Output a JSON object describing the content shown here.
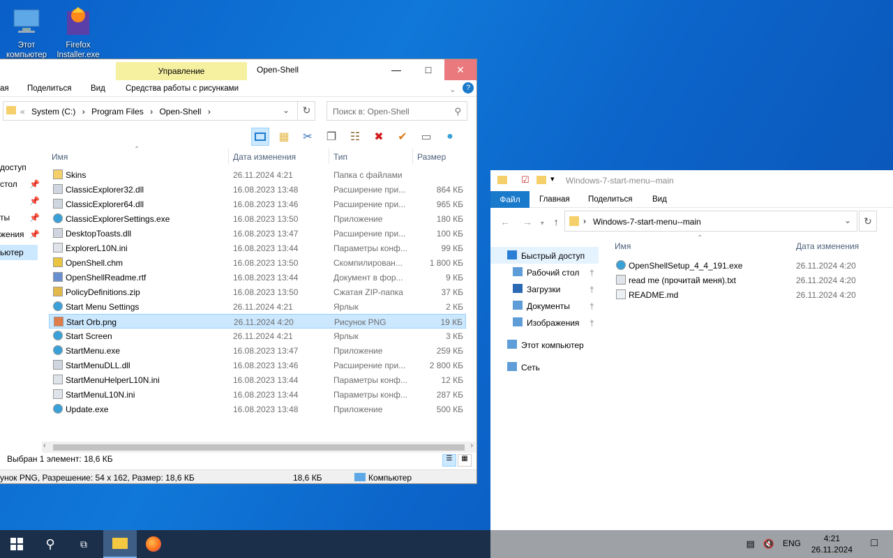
{
  "desktop": {
    "icons": [
      {
        "label": "Этот компьютер",
        "icon": "computer-icon"
      },
      {
        "label": "Firefox Installer.exe",
        "icon": "firefox-installer-icon"
      }
    ]
  },
  "window1": {
    "context_tab": "Управление",
    "title": "Open-Shell",
    "ribbon_tabs": [
      "Поделиться",
      "Вид",
      "Средства работы с рисунками"
    ],
    "ribbon_partial": "ая",
    "breadcrumb": {
      "chevron": "«",
      "parts": [
        "System (C:)",
        "Program Files",
        "Open-Shell"
      ]
    },
    "search_placeholder": "Поиск в: Open-Shell",
    "columns": {
      "name": "Имя",
      "date": "Дата изменения",
      "type": "Тип",
      "size": "Размер"
    },
    "nav_items": [
      "доступ",
      "стол",
      "ты",
      "жения",
      "ьютер"
    ],
    "files": [
      {
        "name": "Skins",
        "date": "26.11.2024 4:21",
        "type": "Папка с файлами",
        "size": "",
        "icon": "folder-icon"
      },
      {
        "name": "ClassicExplorer32.dll",
        "date": "16.08.2023 13:48",
        "type": "Расширение при...",
        "size": "864 КБ",
        "icon": "dll-icon"
      },
      {
        "name": "ClassicExplorer64.dll",
        "date": "16.08.2023 13:46",
        "type": "Расширение при...",
        "size": "965 КБ",
        "icon": "dll-icon"
      },
      {
        "name": "ClassicExplorerSettings.exe",
        "date": "16.08.2023 13:50",
        "type": "Приложение",
        "size": "180 КБ",
        "icon": "shell-icon"
      },
      {
        "name": "DesktopToasts.dll",
        "date": "16.08.2023 13:47",
        "type": "Расширение при...",
        "size": "100 КБ",
        "icon": "dll-icon"
      },
      {
        "name": "ExplorerL10N.ini",
        "date": "16.08.2023 13:44",
        "type": "Параметры конф...",
        "size": "99 КБ",
        "icon": "ini-icon"
      },
      {
        "name": "OpenShell.chm",
        "date": "16.08.2023 13:50",
        "type": "Скомпилирован...",
        "size": "1 800 КБ",
        "icon": "help-icon"
      },
      {
        "name": "OpenShellReadme.rtf",
        "date": "16.08.2023 13:44",
        "type": "Документ в фор...",
        "size": "9 КБ",
        "icon": "doc-icon"
      },
      {
        "name": "PolicyDefinitions.zip",
        "date": "16.08.2023 13:50",
        "type": "Сжатая ZIP-папка",
        "size": "37 КБ",
        "icon": "zip-icon"
      },
      {
        "name": "Start Menu Settings",
        "date": "26.11.2024 4:21",
        "type": "Ярлык",
        "size": "2 КБ",
        "icon": "shortcut-icon"
      },
      {
        "name": "Start Orb.png",
        "date": "26.11.2024 4:20",
        "type": "Рисунок PNG",
        "size": "19 КБ",
        "icon": "image-icon",
        "selected": true
      },
      {
        "name": "Start Screen",
        "date": "26.11.2024 4:21",
        "type": "Ярлык",
        "size": "3 КБ",
        "icon": "shortcut-icon"
      },
      {
        "name": "StartMenu.exe",
        "date": "16.08.2023 13:47",
        "type": "Приложение",
        "size": "259 КБ",
        "icon": "shell-icon"
      },
      {
        "name": "StartMenuDLL.dll",
        "date": "16.08.2023 13:46",
        "type": "Расширение при...",
        "size": "2 800 КБ",
        "icon": "dll-icon"
      },
      {
        "name": "StartMenuHelperL10N.ini",
        "date": "16.08.2023 13:44",
        "type": "Параметры конф...",
        "size": "12 КБ",
        "icon": "ini-icon"
      },
      {
        "name": "StartMenuL10N.ini",
        "date": "16.08.2023 13:44",
        "type": "Параметры конф...",
        "size": "287 КБ",
        "icon": "ini-icon"
      },
      {
        "name": "Update.exe",
        "date": "16.08.2023 13:48",
        "type": "Приложение",
        "size": "500 КБ",
        "icon": "shell-icon"
      }
    ],
    "status": "Выбран 1 элемент: 18,6 КБ",
    "details": {
      "info": "унок PNG, Разрешение: 54 x 162, Размер: 18,6 КБ",
      "size": "18,6 КБ",
      "location": "Компьютер"
    }
  },
  "window2": {
    "title": "Windows-7-start-menu--main",
    "ribbon": {
      "file": "Файл",
      "tabs": [
        "Главная",
        "Поделиться",
        "Вид"
      ]
    },
    "address": "Windows-7-start-menu--main",
    "columns": {
      "name": "Имя",
      "date": "Дата изменения"
    },
    "sidebar": [
      {
        "label": "Быстрый доступ",
        "icon": "star-icon"
      },
      {
        "label": "Рабочий стол",
        "icon": "desktop-icon"
      },
      {
        "label": "Загрузки",
        "icon": "download-icon"
      },
      {
        "label": "Документы",
        "icon": "documents-icon"
      },
      {
        "label": "Изображения",
        "icon": "pictures-icon"
      },
      {
        "label": "Этот компьютер",
        "icon": "computer-icon"
      },
      {
        "label": "Сеть",
        "icon": "network-icon"
      }
    ],
    "files": [
      {
        "name": "OpenShellSetup_4_4_191.exe",
        "date": "26.11.2024 4:20",
        "icon": "shell-icon"
      },
      {
        "name": "read me (прочитай меня).txt",
        "date": "26.11.2024 4:20",
        "icon": "txt-icon"
      },
      {
        "name": "README.md",
        "date": "26.11.2024 4:20",
        "icon": "file-icon"
      }
    ]
  },
  "taskbar": {
    "lang": "ENG",
    "time": "4:21",
    "date": "26.11.2024"
  },
  "colors": {
    "accent": "#1979ca",
    "selection": "#cce8ff",
    "context_tab": "#f6f1a0",
    "close_hover": "#e9797c"
  }
}
